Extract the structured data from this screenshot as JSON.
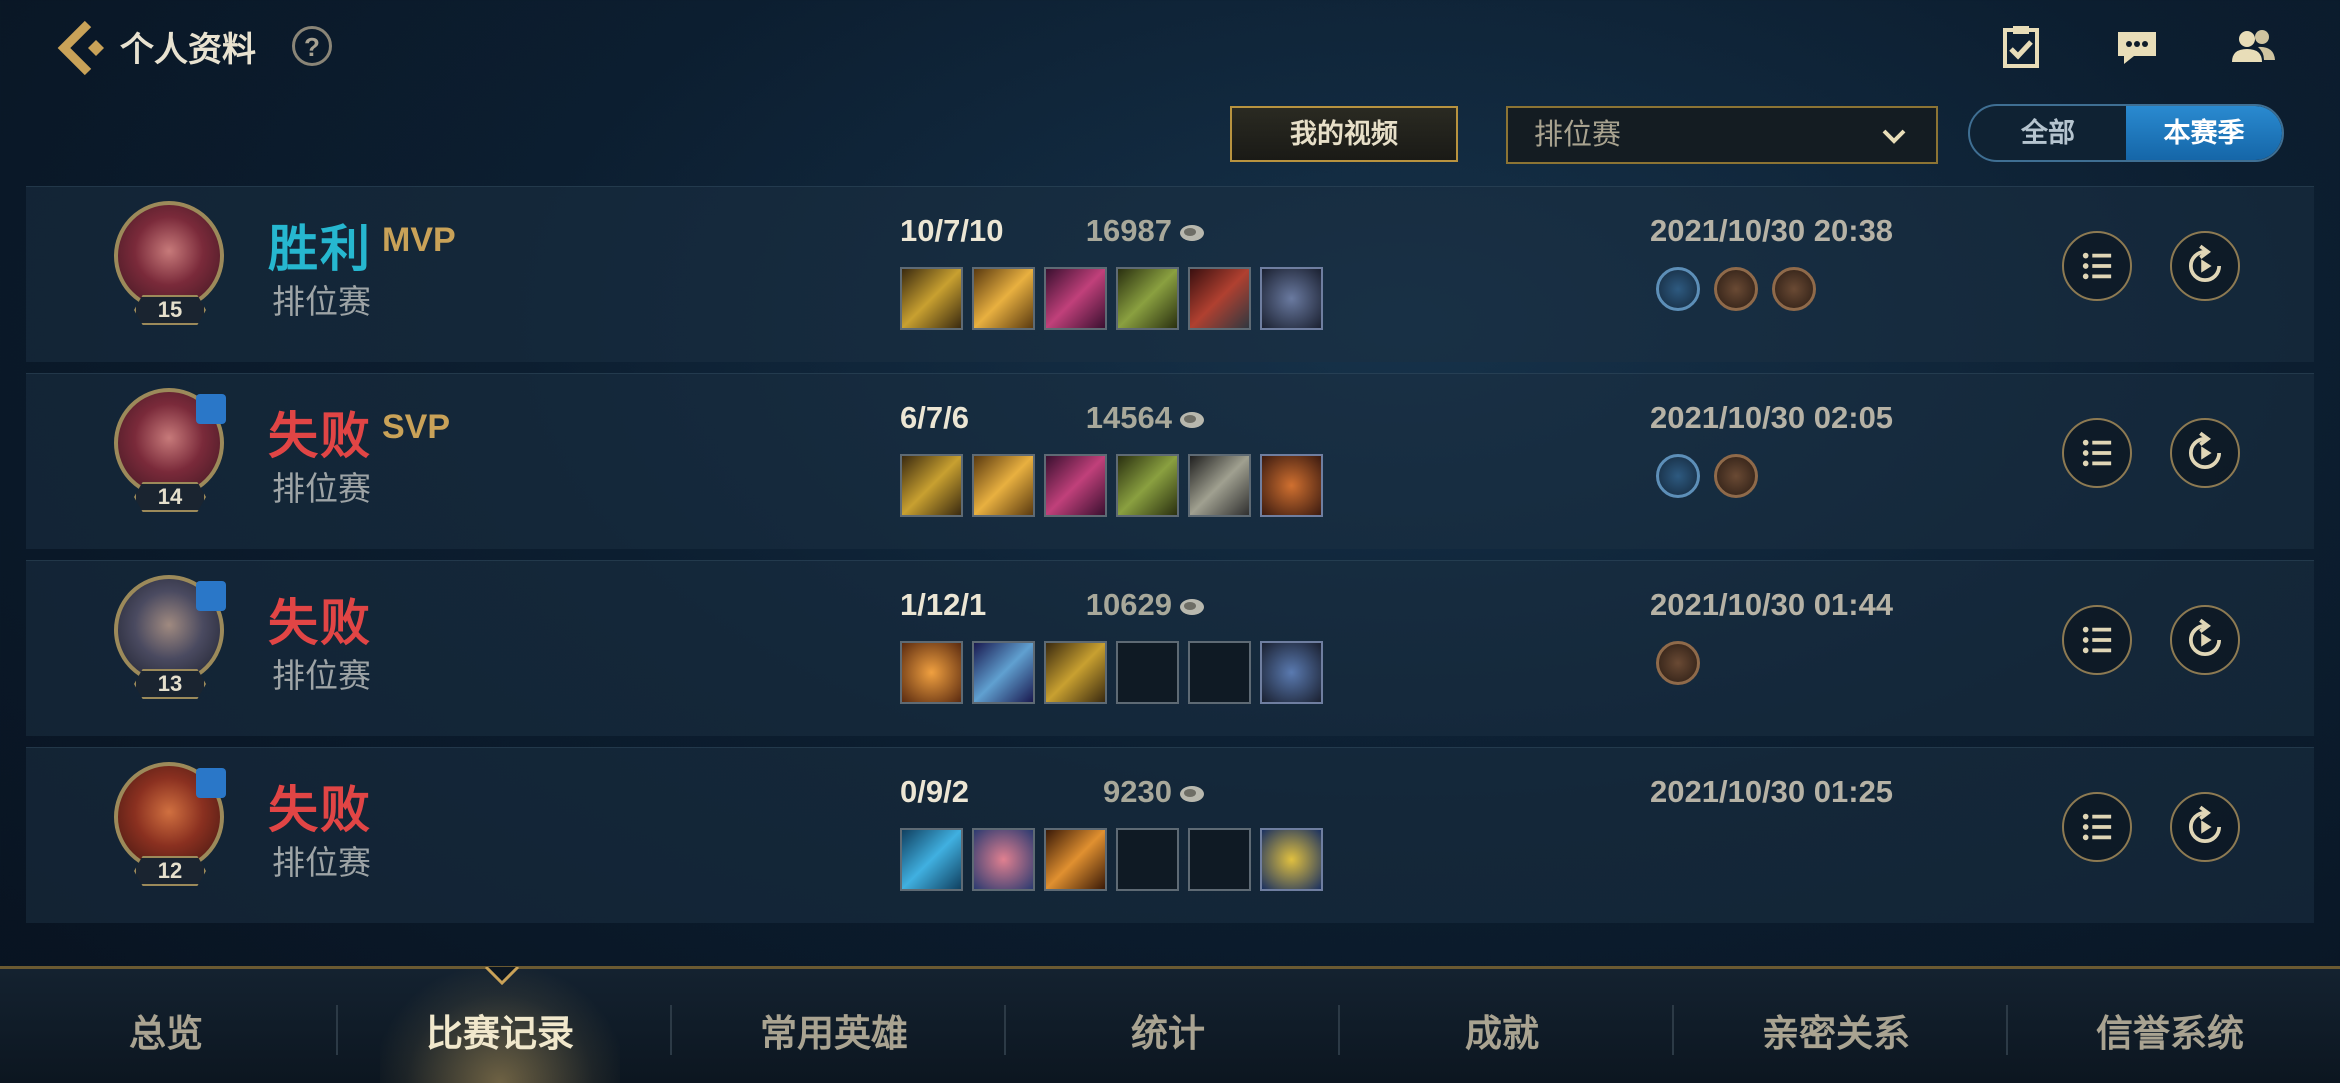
{
  "header": {
    "title": "个人资料",
    "help_glyph": "?",
    "icons": [
      "back-icon",
      "help-icon",
      "task-icon",
      "chat-icon",
      "friends-icon"
    ]
  },
  "controls": {
    "video_button": "我的视频",
    "mode_select_value": "排位赛",
    "season_toggle": {
      "all": "全部",
      "season": "本赛季",
      "selected": "本赛季"
    }
  },
  "matches": [
    {
      "level": "15",
      "result": "胜利",
      "tag": "MVP",
      "mode": "排位赛",
      "kda": "10/7/10",
      "gold": "16987",
      "date": "2021/10/30 20:38",
      "team": false,
      "win": true
    },
    {
      "level": "14",
      "result": "失败",
      "tag": "SVP",
      "mode": "排位赛",
      "kda": "6/7/6",
      "gold": "14564",
      "date": "2021/10/30 02:05",
      "team": true,
      "win": false
    },
    {
      "level": "13",
      "result": "失败",
      "tag": "",
      "mode": "排位赛",
      "kda": "1/12/1",
      "gold": "10629",
      "date": "2021/10/30 01:44",
      "team": true,
      "win": false
    },
    {
      "level": "12",
      "result": "失败",
      "tag": "",
      "mode": "排位赛",
      "kda": "0/9/2",
      "gold": "9230",
      "date": "2021/10/30 01:25",
      "team": true,
      "win": false
    }
  ],
  "bottom_nav": {
    "tabs": [
      "总览",
      "比赛记录",
      "常用英雄",
      "统计",
      "成就",
      "亲密关系",
      "信誉系统"
    ],
    "active": "比赛记录"
  },
  "colors": {
    "win": "#26b7d0",
    "lose": "#e14545",
    "gold_accent": "#c9a258",
    "season_active": "#1f78c0"
  }
}
